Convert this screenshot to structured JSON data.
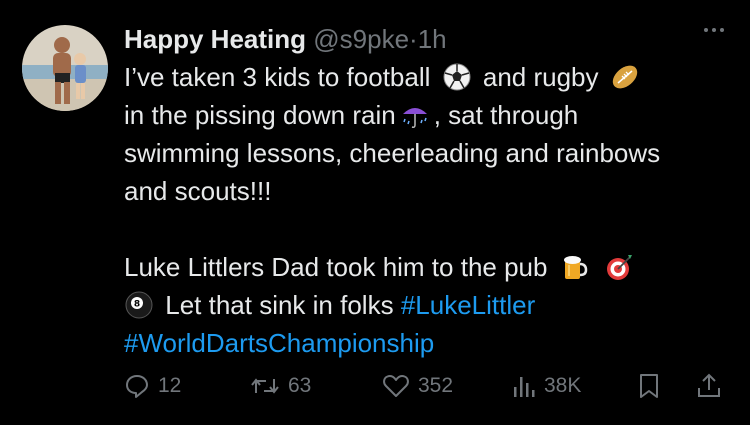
{
  "tweet": {
    "display_name": "Happy Heating",
    "handle": "@s9pke",
    "separator": "·",
    "time": "1h",
    "lines": [
      {
        "a": "I’ve taken 3 kids to football",
        "b": "and rugby"
      },
      {
        "a": "in the pissing down rain",
        "b": ", sat through"
      },
      {
        "a": "swimming lessons, cheerleading and rainbows"
      },
      {
        "a": "and scouts!!!"
      },
      {
        "a": "Luke Littlers Dad took him to the pub"
      },
      {
        "a": "Let that sink in folks",
        "hashtag": "#LukeLittler"
      },
      {
        "hashtag": "#WorldDartsChampionship"
      }
    ],
    "emojis": [
      "soccer-ball",
      "rugby-ball",
      "umbrella-rain",
      "beer-mug",
      "dart-target",
      "pool-8-ball"
    ]
  },
  "actions": {
    "replies": "12",
    "reposts": "63",
    "likes": "352",
    "views": "38K"
  },
  "colors": {
    "background": "#000000",
    "text": "#e7e9ea",
    "muted": "#71767b",
    "link": "#1d9bf0"
  }
}
